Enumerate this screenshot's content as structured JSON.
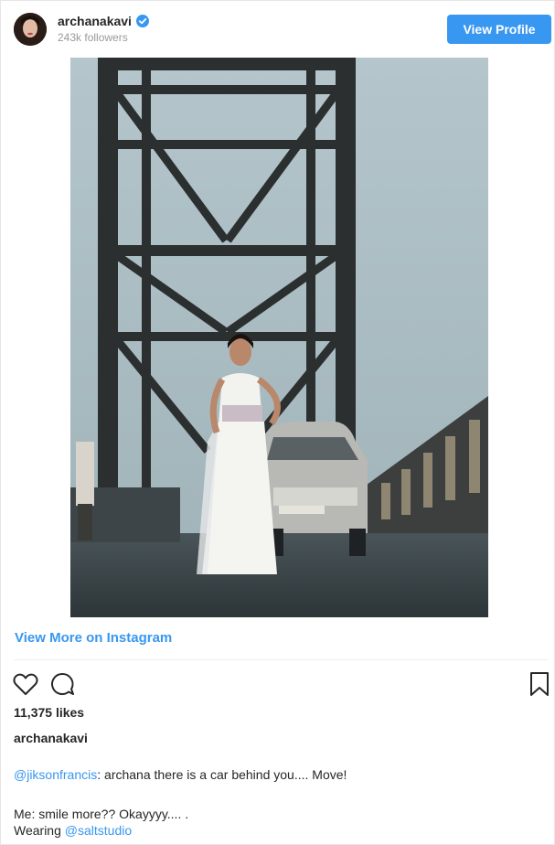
{
  "header": {
    "username": "archanakavi",
    "followers": "243k followers",
    "view_profile_label": "View Profile",
    "verified_color": "#3897f0"
  },
  "post": {
    "image_icon": "photo-of-woman-on-bridge",
    "view_more_label": "View More on Instagram",
    "likes": "11,375 likes",
    "caption_user": "archanakavi",
    "caption": {
      "line1_mention": "@jiksonfrancis",
      "line1_text": ": archana there is a car behind you.... Move!",
      "line2_text": "Me: smile more?? Okayyyy.... .",
      "line3_text": "Wearing ",
      "line3_mention": "@saltstudio"
    }
  },
  "icons": {
    "like": "heart-icon",
    "comment": "comment-icon",
    "save": "bookmark-icon"
  },
  "colors": {
    "accent": "#3897f0",
    "text": "#262626",
    "muted": "#999999"
  }
}
